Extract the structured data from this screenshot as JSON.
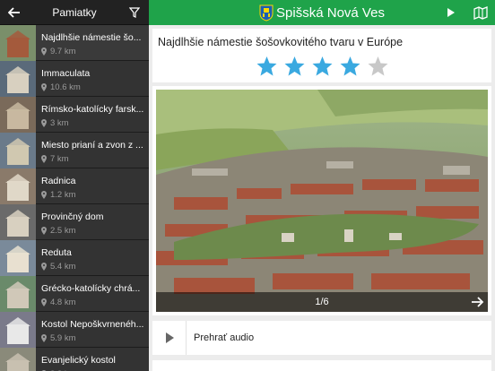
{
  "colors": {
    "accent": "#1fa34a",
    "star_active": "#3aa9e0",
    "star_inactive": "#c8c8c8",
    "sidebar_bg": "#2b2b2b"
  },
  "sidebar": {
    "title": "Pamiatky",
    "back_icon": "arrow-left-icon",
    "filter_icon": "funnel-icon",
    "items": [
      {
        "name": "Najdlhšie námestie šo...",
        "distance": "9.7 km"
      },
      {
        "name": "Immaculata",
        "distance": "10.6 km"
      },
      {
        "name": "Rímsko-katolícky farsk...",
        "distance": "3 km"
      },
      {
        "name": "Miesto prianí a zvon z ...",
        "distance": "7 km"
      },
      {
        "name": "Radnica",
        "distance": "1.2 km"
      },
      {
        "name": "Provinčný dom",
        "distance": "2.5 km"
      },
      {
        "name": "Reduta",
        "distance": "5.4 km"
      },
      {
        "name": "Grécko-katolícky chrá...",
        "distance": "4.8 km"
      },
      {
        "name": "Kostol Nepoškvrnenéh...",
        "distance": "5.9 km"
      },
      {
        "name": "Evanjelický kostol",
        "distance": "8.8 km"
      }
    ]
  },
  "topbar": {
    "city": "Spišská Nová Ves",
    "crest_icon": "city-crest-icon",
    "play_icon": "play-icon",
    "map_icon": "map-icon"
  },
  "detail": {
    "title": "Najdlhšie námestie šošovkovitého tvaru v Európe",
    "rating": 4,
    "rating_max": 5,
    "photo_counter": "1/6",
    "audio_label": "Prehrať audio"
  }
}
